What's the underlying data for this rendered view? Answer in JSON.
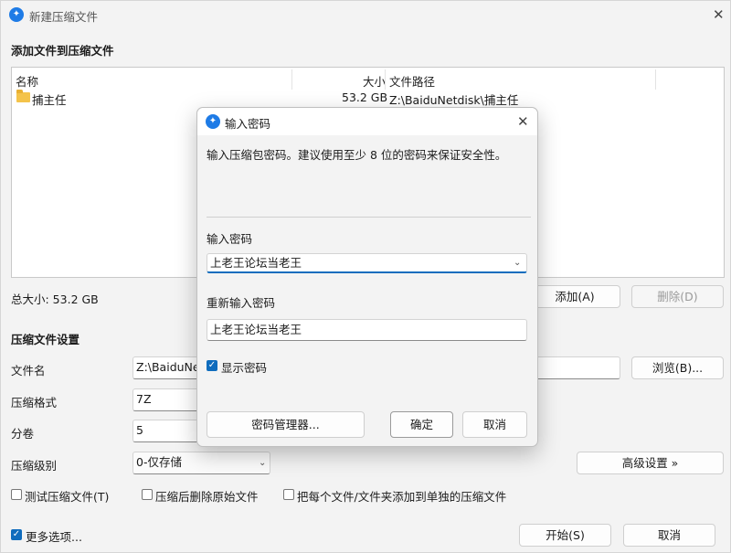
{
  "window": {
    "title": "新建压缩文件"
  },
  "files": {
    "section_title": "添加文件到压缩文件",
    "columns": {
      "name": "名称",
      "size": "大小",
      "path": "文件路径"
    },
    "rows": [
      {
        "name": "捕主任",
        "size": "53.2 GB",
        "path": "Z:\\BaiduNetdisk\\捕主任"
      }
    ],
    "total": "总大小: 53.2 GB",
    "add_label": "添加(A)",
    "delete_label": "删除(D)"
  },
  "settings": {
    "section_title": "压缩文件设置",
    "filename_label": "文件名",
    "filename_value": "Z:\\BaiduNet",
    "browse_label": "浏览(B)...",
    "format_label": "压缩格式",
    "format_value": "7Z",
    "volume_label": "分卷",
    "volume_value": "5",
    "level_label": "压缩级别",
    "level_value": "0-仅存储",
    "advanced_label": "高级设置 »",
    "test_label": "测试压缩文件(T)",
    "delete_after_label": "压缩后删除原始文件",
    "separate_label": "把每个文件/文件夹添加到单独的压缩文件"
  },
  "footer": {
    "more_options_label": "更多选项...",
    "start_label": "开始(S)",
    "cancel_label": "取消"
  },
  "dialog": {
    "title": "输入密码",
    "description": "输入压缩包密码。建议使用至少 8 位的密码来保证安全性。",
    "password_label": "输入密码",
    "password_value": "上老王论坛当老王",
    "reenter_label": "重新输入密码",
    "reenter_value": "上老王论坛当老王",
    "show_password_label": "显示密码",
    "manager_label": "密码管理器...",
    "ok_label": "确定",
    "cancel_label": "取消"
  },
  "icons": {
    "app": "app-logo-icon",
    "folder": "folder-icon",
    "close": "close-icon",
    "chevron": "chevron-down-icon",
    "check": "checkmark-icon"
  },
  "colors": {
    "accent": "#0f6cbd",
    "app_icon": "#1e7be6",
    "folder": "#f4c34a"
  }
}
